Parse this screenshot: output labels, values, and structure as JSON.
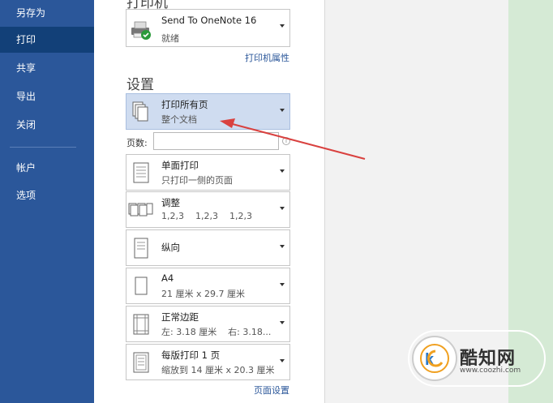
{
  "nav": {
    "items": [
      "另存为",
      "打印",
      "共享",
      "导出",
      "关闭",
      "帐户",
      "选项"
    ],
    "active": "打印"
  },
  "printer": {
    "heading": "打印机",
    "name": "Send To OneNote 16",
    "status": "就绪",
    "properties_link": "打印机属性"
  },
  "settings": {
    "heading": "设置",
    "what": {
      "line1": "打印所有页",
      "line2": "整个文档"
    },
    "pages_label": "页数:",
    "pages_value": "",
    "sides": {
      "line1": "单面打印",
      "line2": "只打印一侧的页面"
    },
    "collate": {
      "line1": "调整",
      "line2": "1,2,3    1,2,3    1,2,3"
    },
    "orientation": {
      "line1": "纵向"
    },
    "paper": {
      "line1": "A4",
      "line2": "21 厘米 x 29.7 厘米"
    },
    "margins": {
      "line1": "正常边距",
      "line2": "左: 3.18 厘米    右: 3.18..."
    },
    "per_sheet": {
      "line1": "每版打印 1 页",
      "line2": "缩放到 14 厘米 x 20.3 厘米"
    },
    "page_setup_link": "页面设置"
  },
  "watermark": {
    "brand": "酷知网",
    "url": "www.coozhi.com"
  },
  "colors": {
    "nav_bg": "#2b579a",
    "nav_active": "#124078",
    "selected_bg": "#cfdcf0",
    "annotation_arrow": "#d9413f"
  }
}
